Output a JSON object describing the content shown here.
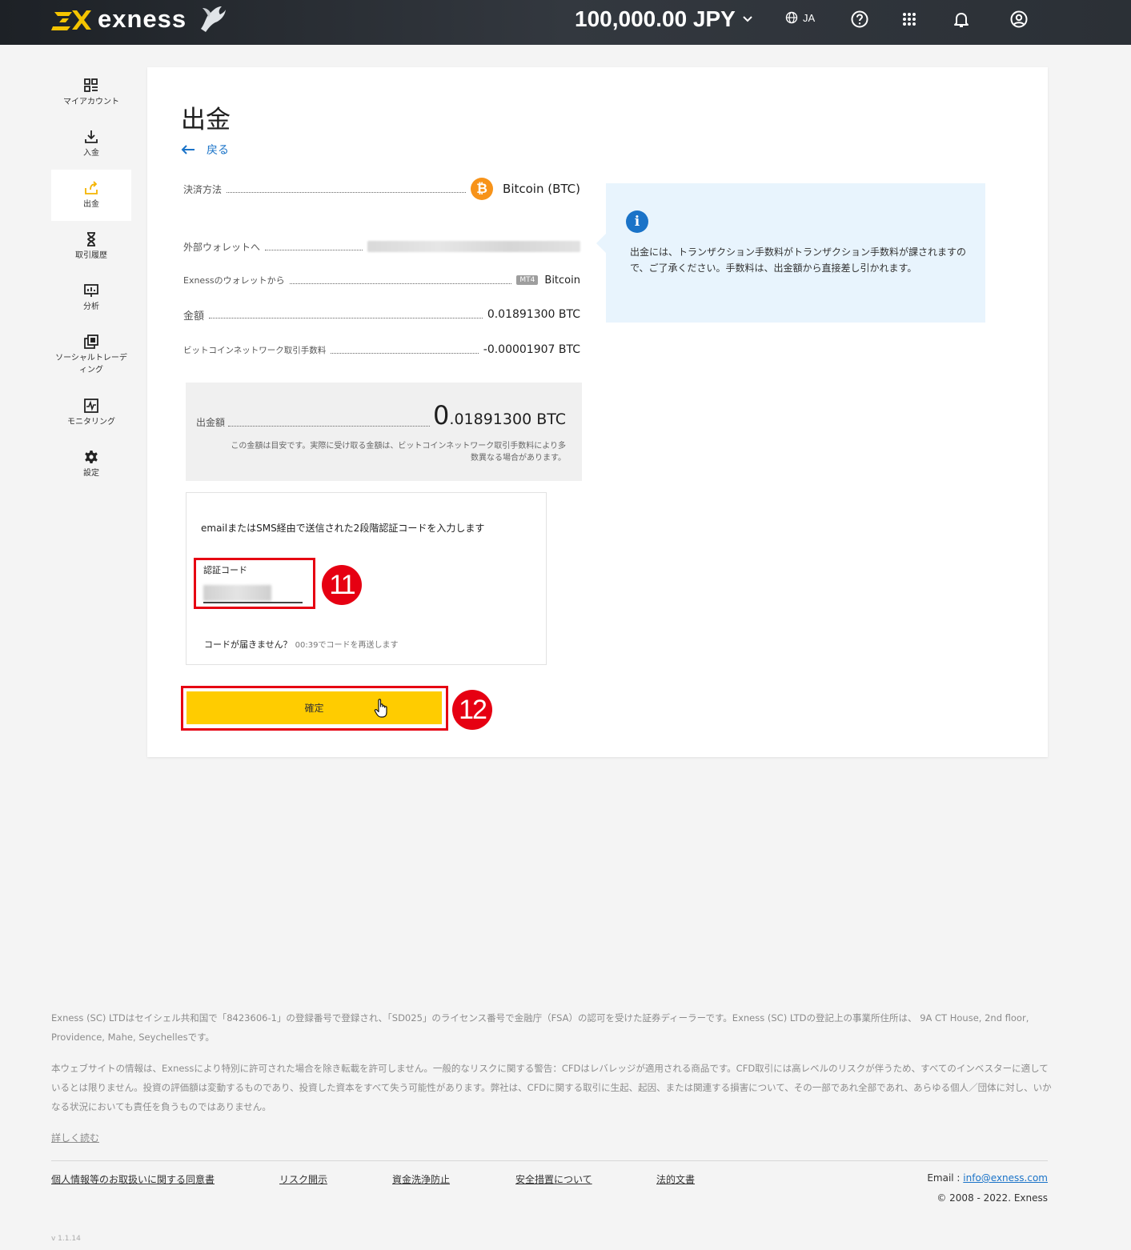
{
  "header": {
    "brand": "exness",
    "balance": "100,000.00 JPY",
    "language": "JA"
  },
  "sidebar": {
    "items": [
      {
        "label": "マイアカウント",
        "icon": "dashboard-icon"
      },
      {
        "label": "入金",
        "icon": "deposit-icon"
      },
      {
        "label": "出金",
        "icon": "withdraw-icon",
        "active": true
      },
      {
        "label": "取引履歴",
        "icon": "hourglass-icon"
      },
      {
        "label": "分析",
        "icon": "analytics-icon"
      },
      {
        "label": "ソーシャルトレーディング",
        "icon": "copy-icon"
      },
      {
        "label": "モニタリング",
        "icon": "monitoring-icon"
      },
      {
        "label": "設定",
        "icon": "gear-icon"
      }
    ]
  },
  "page": {
    "title": "出金",
    "back_label": "戻る"
  },
  "details": {
    "method_label": "決済方法",
    "method_value": "Bitcoin (BTC)",
    "to_label": "外部ウォレットへ",
    "from_label": "Exnessのウォレットから",
    "from_badge": "MT4",
    "from_value": "Bitcoin",
    "amount_label": "金額",
    "amount_value": "0.01891300 BTC",
    "fee_label": "ビットコインネットワーク取引手数料",
    "fee_value": "-0.00001907 BTC"
  },
  "summary": {
    "label": "出金額",
    "amount_int": "0",
    "amount_rest": ".01891300 BTC",
    "note": "この金額は目安です。実際に受け取る金額は、ビットコインネットワーク取引手数料により多数異なる場合があります。"
  },
  "info": {
    "text": "出金には、トランザクション手数料がトランザクション手数料が課されますので、ご了承ください。手数料は、出金額から直接差し引かれます。"
  },
  "tfa": {
    "prompt": "emailまたはSMS経由で送信された2段階認証コードを入力します",
    "code_label": "認証コード",
    "resend_text": "コードが届きません？",
    "resend_timer": "00:39でコードを再送します"
  },
  "annotations": {
    "step_code": "11",
    "step_confirm": "12"
  },
  "confirm_label": "確定",
  "footer": {
    "para1": "Exness (SC) LTDはセイシェル共和国で「8423606-1」の登録番号で登録され、「SD025」のライセンス番号で金融庁（FSA）の認可を受けた証券ディーラーです。Exness (SC) LTDの登記上の事業所住所は、 9A CT House, 2nd floor, Providence, Mahe, Seychellesです。",
    "para2": "本ウェブサイトの情報は、Exnessにより特別に許可された場合を除き転載を許可しません。一般的なリスクに関する警告：CFDはレバレッジが適用される商品です。CFD取引には高レベルのリスクが伴うため、すべてのインベスターに適しているとは限りません。投資の評価額は変動するものであり、投資した資本をすべて失う可能性があります。弊社は、CFDに関する取引に生起、起因、または関連する損害について、その一部であれ全部であれ、あらゆる個人／団体に対し、いかなる状況においても責任を負うものではありません。",
    "read_more": "詳しく読む",
    "links": [
      "個人情報等のお取扱いに関する同意書",
      "リスク開示",
      "資金洗浄防止",
      "安全措置について",
      "法的文書"
    ],
    "email_label": "Email : ",
    "email": "info@exness.com",
    "copyright": "© 2008 - 2022. Exness",
    "version": "v 1.1.14"
  },
  "colors": {
    "accent_yellow": "#ffcc00",
    "link_blue": "#1a73c8",
    "annotation_red": "#e60012",
    "bitcoin_orange": "#f7931a",
    "info_bg": "#e8f4fd"
  }
}
